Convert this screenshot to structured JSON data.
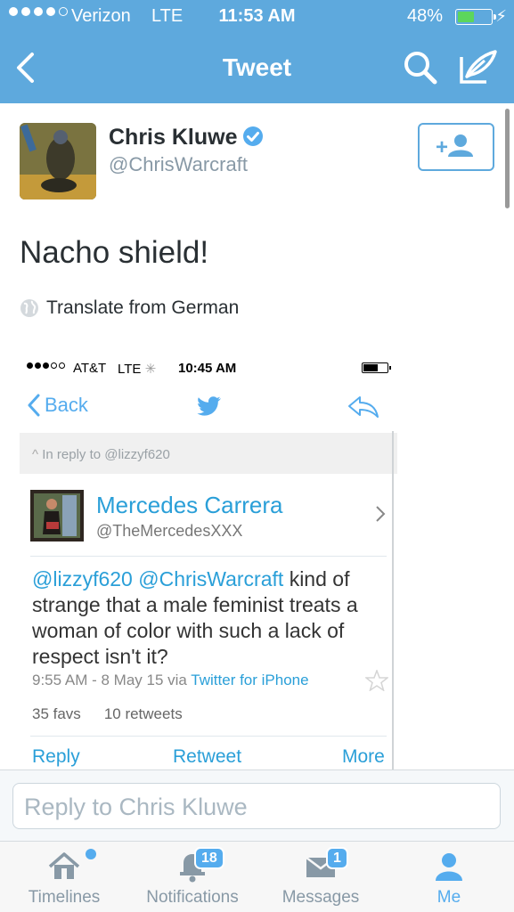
{
  "status_bar": {
    "carrier": "Verizon",
    "network": "LTE",
    "time": "11:53 AM",
    "battery_percent": "48%",
    "battery_level": 0.48
  },
  "nav": {
    "title": "Tweet"
  },
  "tweet": {
    "author_name": "Chris Kluwe",
    "author_handle": "@ChrisWarcraft",
    "verified": true,
    "text": "Nacho shield!",
    "translate_label": "Translate from German"
  },
  "embedded_screenshot": {
    "status": {
      "carrier": "AT&T",
      "network": "LTE",
      "time": "10:45 AM"
    },
    "back_label": "Back",
    "in_reply_to": "In reply to @lizzyf620",
    "author_name": "Mercedes Carrera",
    "author_handle": "@TheMercedesXXX",
    "text_mention_1": "@lizzyf620",
    "text_mention_2": "@ChrisWarcraft",
    "text_line_1_rest": "kind",
    "text_rest": "of strange that a male feminist treats a woman of color with such a lack of respect isn't it?",
    "timestamp": "9:55 AM - 8 May 15 via",
    "client": "Twitter for iPhone",
    "favs": "35 favs",
    "retweets": "10 retweets",
    "actions": {
      "reply": "Reply",
      "retweet": "Retweet",
      "more": "More"
    }
  },
  "reply_box": {
    "placeholder": "Reply to Chris Kluwe"
  },
  "tabs": [
    {
      "label": "Timelines",
      "icon": "home-icon",
      "badge": "",
      "dot": true,
      "active": false
    },
    {
      "label": "Notifications",
      "icon": "bell-icon",
      "badge": "18",
      "active": false
    },
    {
      "label": "Messages",
      "icon": "envelope-icon",
      "badge": "1",
      "active": false
    },
    {
      "label": "Me",
      "icon": "person-icon",
      "badge": "",
      "active": true
    }
  ],
  "colors": {
    "header": "#5ea9dd",
    "accent": "#55acee",
    "link": "#2a9fd8",
    "muted": "#8899a6"
  }
}
